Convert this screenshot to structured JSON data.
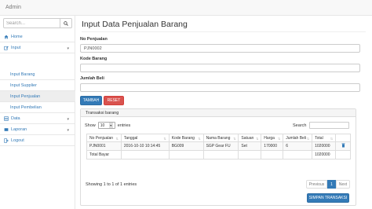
{
  "app": {
    "title": "Admin"
  },
  "sidebar": {
    "search_placeholder": "Search...",
    "items": [
      {
        "label": "Home"
      },
      {
        "label": "Input"
      },
      {
        "label": "Input Barang"
      },
      {
        "label": "Input Supplier"
      },
      {
        "label": "Input Penjualan"
      },
      {
        "label": "Input Pembelian"
      },
      {
        "label": "Data"
      },
      {
        "label": "Laporan"
      },
      {
        "label": "Logout"
      }
    ]
  },
  "page": {
    "title": "Input Data Penjualan Barang"
  },
  "form": {
    "no_penjualan_label": "No Penjualan",
    "no_penjualan_value": "PJN0002",
    "kode_barang_label": "Kode Barang",
    "kode_barang_value": "",
    "jumlah_beli_label": "Jumlah Beli",
    "jumlah_beli_value": "",
    "tambah_label": "TAMBAH",
    "reset_label": "RESET"
  },
  "panel": {
    "heading": "Transaksi barang"
  },
  "datatable": {
    "show_label": "Show",
    "entries_value": "10",
    "entries_label": "entries",
    "search_label": "Search",
    "columns": [
      "No Penjualan",
      "Tanggal",
      "Kode Barang",
      "Nama Barang",
      "Satuan",
      "Harga",
      "Jumlah Beli",
      "Total",
      ""
    ],
    "rows": [
      [
        "PJN0001",
        "2016-10-10 10:14:45",
        "BG009",
        "SGP Gear FU",
        "Set",
        "170000",
        "6",
        "1020000"
      ]
    ],
    "total_row": {
      "label": "Total Bayar",
      "value": "1020000"
    },
    "info": "Showing 1 to 1 of 1 entries",
    "pagination": {
      "previous": "Previous",
      "page": "1",
      "next": "Next"
    },
    "save_button": "SIMPAN TRANSAKSI"
  }
}
